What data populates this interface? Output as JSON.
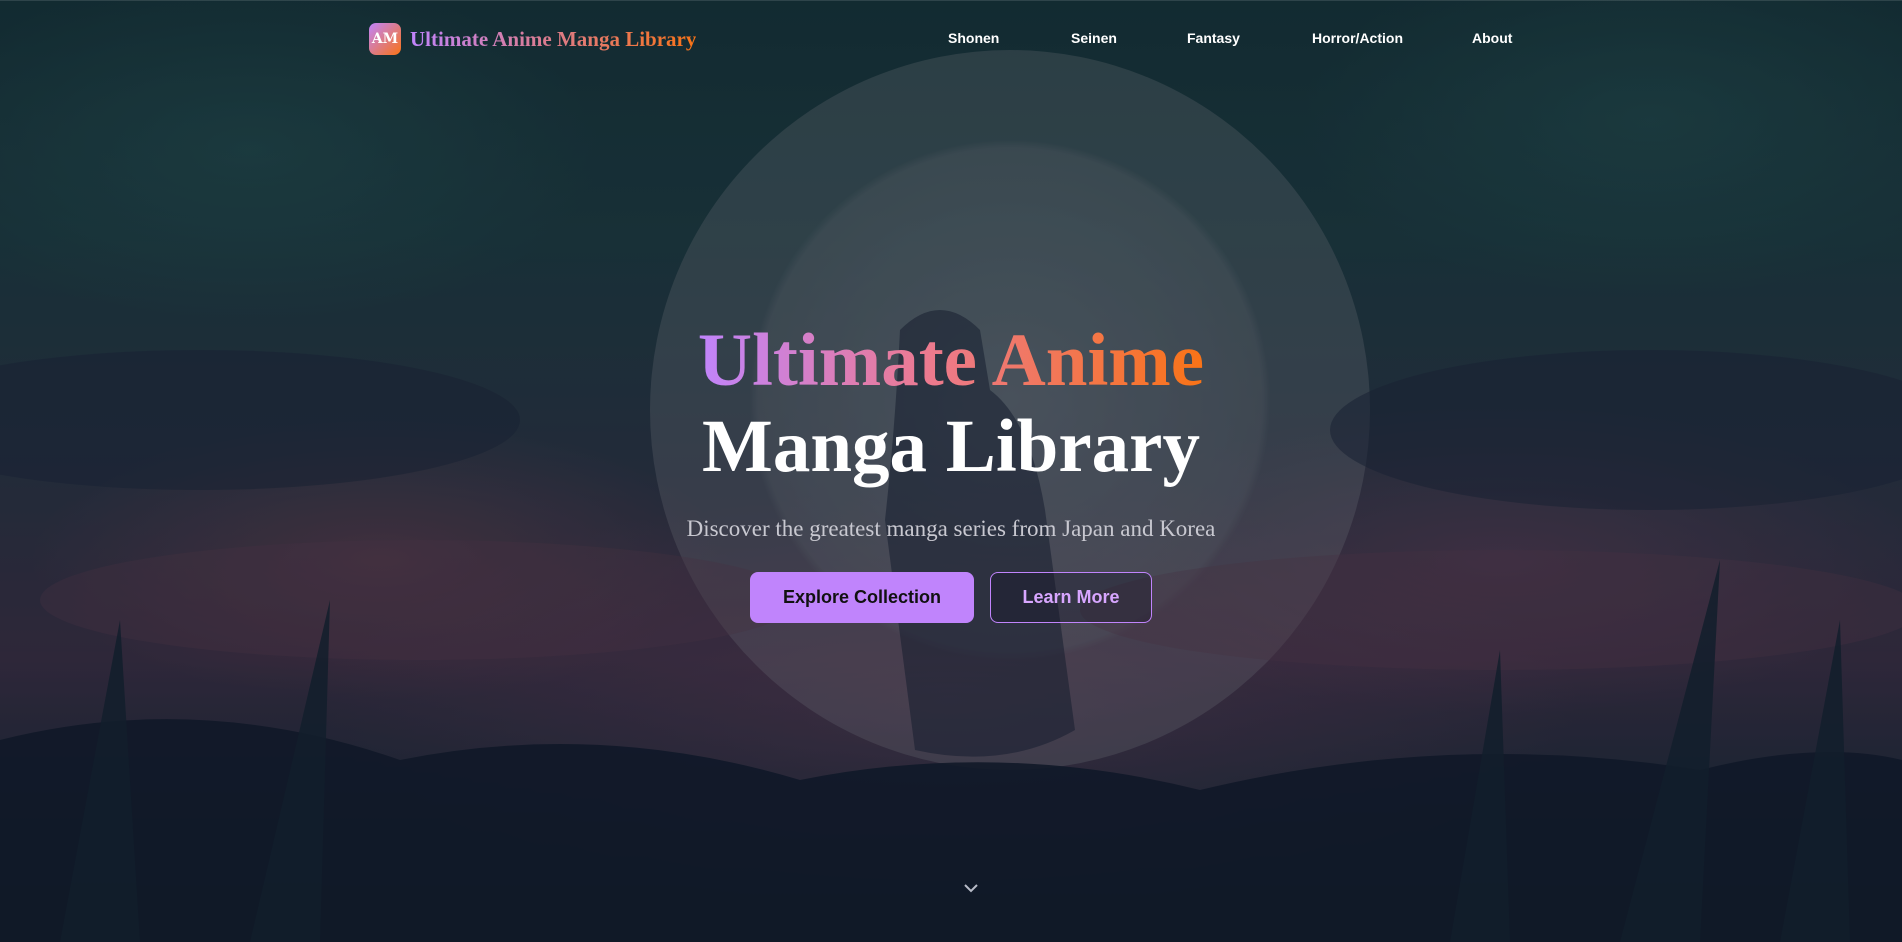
{
  "brand": {
    "logo_text": "AM",
    "name": "Ultimate Anime Manga Library"
  },
  "nav": {
    "items": [
      {
        "label": "Shonen"
      },
      {
        "label": "Seinen"
      },
      {
        "label": "Fantasy"
      },
      {
        "label": "Horror/Action"
      },
      {
        "label": "About"
      }
    ]
  },
  "hero": {
    "title_line1": "Ultimate Anime",
    "title_line2": "Manga Library",
    "subtitle": "Discover the greatest manga series from Japan and Korea",
    "primary_button": "Explore Collection",
    "secondary_button": "Learn More",
    "scroll_icon": "chevron-down-icon"
  },
  "colors": {
    "accent_purple": "#c084fc",
    "accent_orange": "#f97316",
    "text_white": "#ffffff"
  }
}
